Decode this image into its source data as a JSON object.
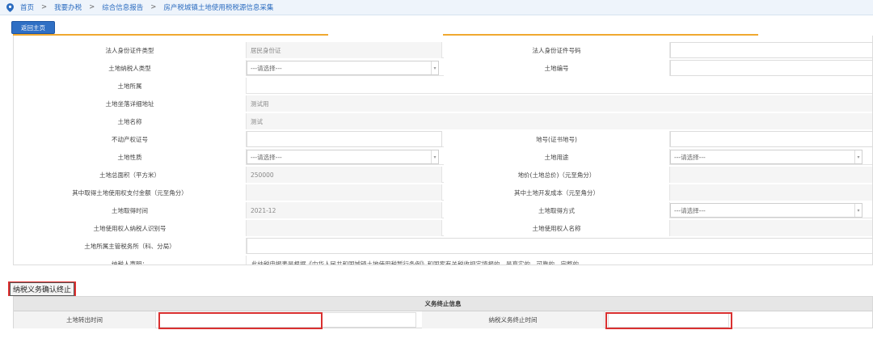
{
  "breadcrumb": {
    "items": [
      "首页",
      "我要办税",
      "综合信息报告",
      "房产税城镇土地使用税税源信息采集"
    ],
    "separator": ">"
  },
  "back_button": "返回主页",
  "form": {
    "rows": [
      {
        "l1": "法人身份证件类型",
        "v1": "居民身份证",
        "l2": "法人身份证件号码",
        "v2": ""
      },
      {
        "l1": "土地纳税人类型",
        "v1": "---请选择---",
        "l2": "土地编号",
        "v2": ""
      },
      {
        "l1": "土地所属",
        "v1": ""
      },
      {
        "l1": "土地坐落详细地址",
        "v1": "测试用"
      },
      {
        "l1": "土地名称",
        "v1": "测试"
      },
      {
        "l1": "不动产权证号",
        "v1": "",
        "l2": "地号(证书地号)",
        "v2": ""
      },
      {
        "l1": "土地性质",
        "v1": "---请选择---",
        "l2": "土地用途",
        "v2": "---请选择---"
      },
      {
        "l1": "土地总面积（平方米）",
        "v1": "250000",
        "l2": "地价(土地总价)（元至角分）",
        "v2": ""
      },
      {
        "l1": "其中取得土地使用权支付金额（元至角分）",
        "v1": "",
        "l2": "其中土地开发成本（元至角分）",
        "v2": ""
      },
      {
        "l1": "土地取得时间",
        "v1": "2021-12",
        "l2": "土地取得方式",
        "v2": "---请选择---"
      },
      {
        "l1": "土地使用权人纳税人识别号",
        "v1": "",
        "l2": "土地使用权人名称",
        "v2": ""
      },
      {
        "l1": "土地所属主管税务所（科、分局）",
        "v1": ""
      },
      {
        "l1": "纳税人声明：",
        "v1": "此纳税申报表是根据《中华人民共和国城镇土地使用税暂行条例》和国家有关税收规定填报的，是真实的、可靠的、完整的。"
      }
    ]
  },
  "termination": {
    "button": "纳税义务确认终止",
    "section_title": "义务终止信息",
    "transfer_label": "土地转出时间",
    "transfer_value": "",
    "end_label": "纳税义务终止时间",
    "end_value": ""
  },
  "colors": {
    "accent": "#2f6fc4",
    "highlight": "#d93030",
    "orange": "#f0a830"
  }
}
